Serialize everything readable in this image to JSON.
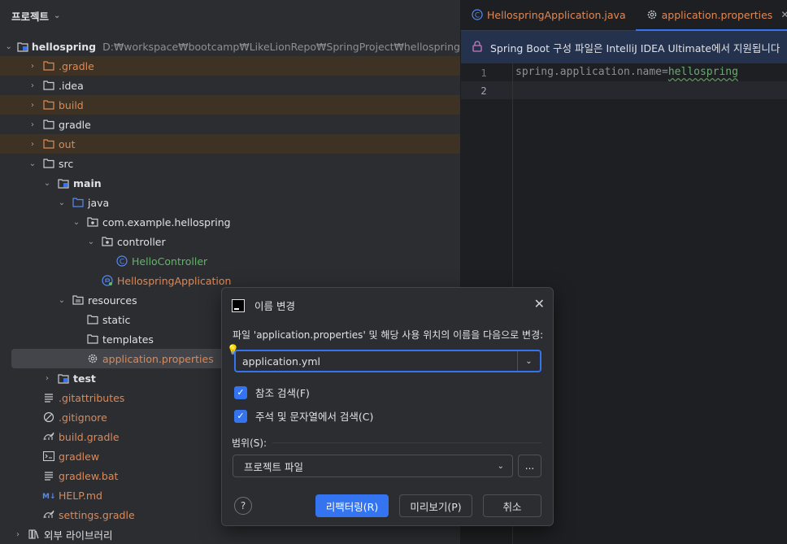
{
  "project_panel": {
    "title": "프로젝트",
    "root_name": "hellospring",
    "root_path": "D:₩workspace₩bootcamp₩LikeLionRepo₩SpringProject₩hellospring",
    "items": [
      {
        "label": ".gradle",
        "ignored": true
      },
      {
        "label": ".idea"
      },
      {
        "label": "build",
        "ignored": true
      },
      {
        "label": "gradle"
      },
      {
        "label": "out",
        "ignored": true
      },
      {
        "label": "src"
      },
      {
        "label": "main"
      },
      {
        "label": "java"
      },
      {
        "label": "com.example.hellospring"
      },
      {
        "label": "controller"
      },
      {
        "label": "HelloController"
      },
      {
        "label": "HellospringApplication"
      },
      {
        "label": "resources"
      },
      {
        "label": "static"
      },
      {
        "label": "templates"
      },
      {
        "label": "application.properties",
        "selected": true
      },
      {
        "label": "test"
      },
      {
        "label": ".gitattributes"
      },
      {
        "label": ".gitignore"
      },
      {
        "label": "build.gradle"
      },
      {
        "label": "gradlew"
      },
      {
        "label": "gradlew.bat"
      },
      {
        "label": "HELP.md"
      },
      {
        "label": "settings.gradle"
      },
      {
        "label": "외부 라이브러리"
      }
    ]
  },
  "editor": {
    "tabs": [
      {
        "label": "HellospringApplication.java"
      },
      {
        "label": "application.properties",
        "active": true
      }
    ],
    "banner": "Spring Boot 구성 파일은 IntelliJ IDEA Ultimate에서 지원됩니다",
    "line_numbers": [
      "1",
      "2"
    ],
    "code_key": "spring.application.name=",
    "code_value": "hellospring"
  },
  "dialog": {
    "title": "이름 변경",
    "description": "파일 'application.properties' 및 해당 사용 위치의 이름을 다음으로 변경:",
    "new_name": "application.yml",
    "checkbox_refs": "참조 검색(F)",
    "checkbox_comments": "주석 및 문자열에서 검색(C)",
    "scope_label": "범위(S):",
    "scope_value": "프로젝트 파일",
    "more_label": "...",
    "help_label": "?",
    "refactor_label": "리팩터링(R)",
    "preview_label": "미리보기(P)",
    "cancel_label": "취소"
  },
  "colors": {
    "accent": "#3574f0",
    "ignored_bg": "#3d3223",
    "orange_text": "#e08855",
    "green_text": "#5fb865"
  }
}
